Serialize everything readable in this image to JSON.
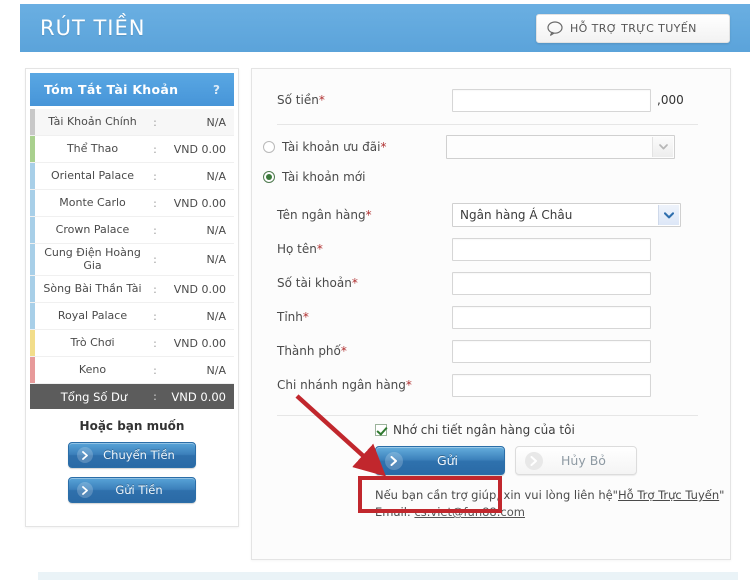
{
  "header": {
    "title": "RÚT TIỀN",
    "support_button": "HỖ TRỢ TRỰC TUYẾN",
    "support_icon": "speech-bubble-icon",
    "bg_color": "#5ba3da"
  },
  "sidebar": {
    "panel_title": "Tóm Tắt Tài Khoản",
    "help_marker": "?",
    "rows": [
      {
        "name": "Tài Khoản Chính",
        "value": "N/A",
        "color": "#c8c8c8"
      },
      {
        "name": "Thể Thao",
        "value": "VND 0.00",
        "color": "#a9d08e"
      },
      {
        "name": "Oriental Palace",
        "value": "N/A",
        "color": "#a8cfe8"
      },
      {
        "name": "Monte Carlo",
        "value": "VND 0.00",
        "color": "#a8cfe8"
      },
      {
        "name": "Crown Palace",
        "value": "N/A",
        "color": "#a8cfe8"
      },
      {
        "name": "Cung Điện Hoàng Gia",
        "value": "N/A",
        "color": "#a8cfe8"
      },
      {
        "name": "Sòng Bài Thần Tài",
        "value": "VND 0.00",
        "color": "#a8cfe8"
      },
      {
        "name": "Royal Palace",
        "value": "N/A",
        "color": "#a8cfe8"
      },
      {
        "name": "Trò Chơi",
        "value": "VND 0.00",
        "color": "#f2dd8a"
      },
      {
        "name": "Keno",
        "value": "N/A",
        "color": "#e79a9a"
      }
    ],
    "colon": ":",
    "total": {
      "label": "Tổng Số Dư",
      "colon": ":",
      "value": "VND 0.00"
    },
    "footer_title": "Hoặc bạn muốn",
    "buttons": [
      {
        "label": "Chuyển Tiền",
        "icon": "chevron-right-icon"
      },
      {
        "label": "Gửi Tiền",
        "icon": "chevron-right-icon"
      }
    ]
  },
  "form": {
    "amount": {
      "label": "Số tiền",
      "required": "*",
      "value": "",
      "suffix": ",000"
    },
    "account_option_existing": {
      "label": "Tài khoản ưu đãi",
      "required": "*",
      "selected": false,
      "select_value": ""
    },
    "account_option_new": {
      "label": "Tài khoản mới",
      "selected": true
    },
    "bank_name": {
      "label": "Tên ngân hàng",
      "required": "*",
      "value": "Ngân hàng Á Châu"
    },
    "full_name": {
      "label": "Họ tên",
      "required": "*",
      "value": ""
    },
    "account_number": {
      "label": "Số tài khoản",
      "required": "*",
      "value": ""
    },
    "province": {
      "label": "Tỉnh",
      "required": "*",
      "value": ""
    },
    "city": {
      "label": "Thành phố",
      "required": "*",
      "value": ""
    },
    "bank_branch": {
      "label": "Chi nhánh ngân hàng",
      "required": "*",
      "value": ""
    },
    "remember_checkbox": {
      "label": "Nhớ chi tiết ngân hàng của tôi",
      "checked": true
    },
    "submit_button": {
      "label": "Gửi",
      "icon": "chevron-right-icon"
    },
    "cancel_button": {
      "label": "Hủy Bỏ",
      "icon": "chevron-right-icon"
    }
  },
  "footer": {
    "help_prefix": "Nếu bạn cần trợ giúp, xin vui lòng liên hệ\"",
    "help_link": "Hỗ Trợ Trực Tuyến",
    "help_suffix": "\"",
    "email_label": "Email:",
    "email": "cs.viet@fun88.com"
  },
  "annotations": {
    "arrow_color": "#c1272d",
    "highlight_box_color": "#c1272d"
  }
}
